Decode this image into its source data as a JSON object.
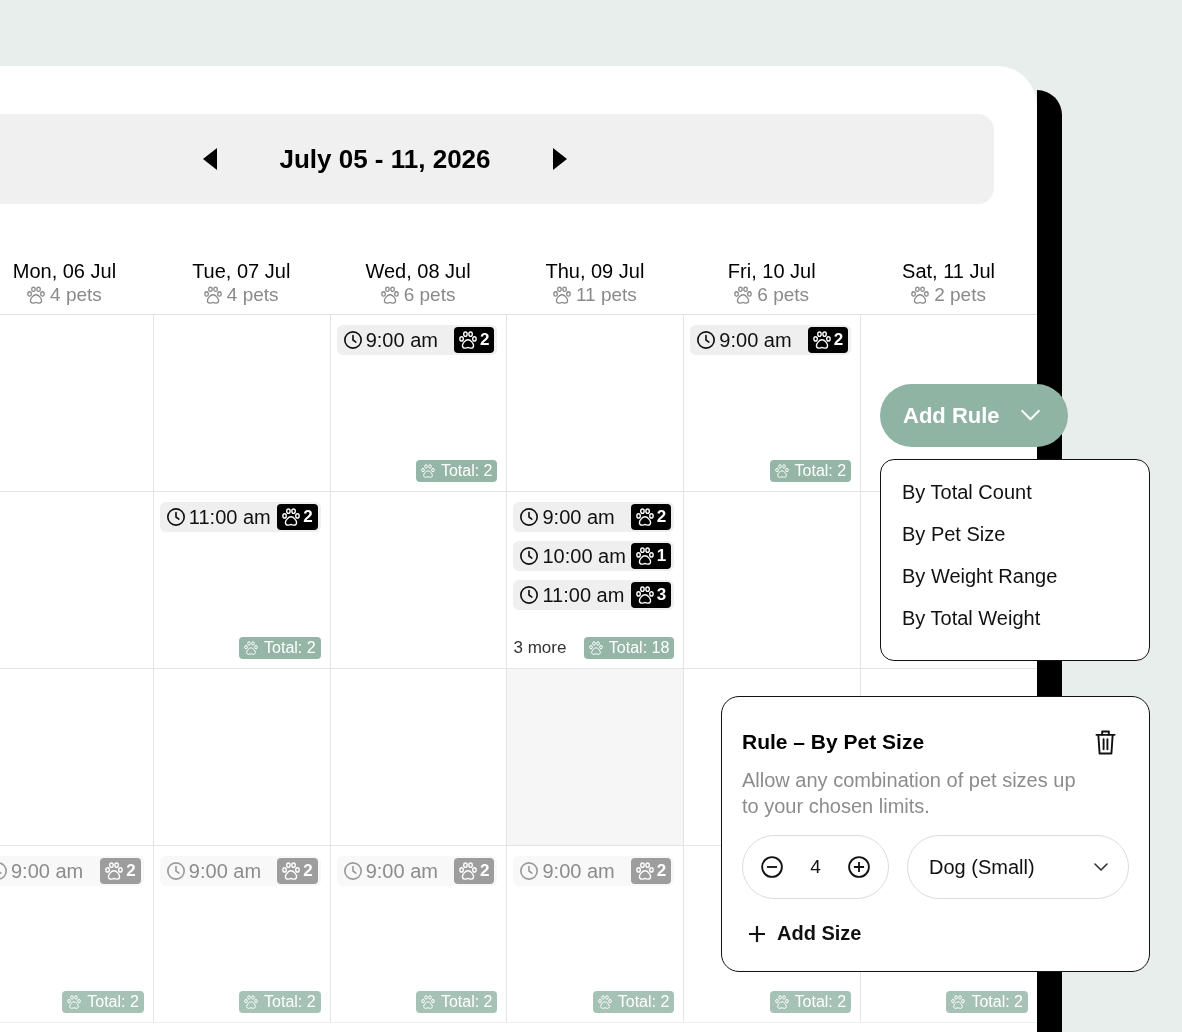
{
  "week_nav": {
    "title": "July 05 - 11, 2026"
  },
  "days": [
    {
      "label": "Mon, 06 Jul",
      "pets": "4 pets"
    },
    {
      "label": "Tue, 07 Jul",
      "pets": "4 pets"
    },
    {
      "label": "Wed, 08 Jul",
      "pets": "6 pets"
    },
    {
      "label": "Thu, 09 Jul",
      "pets": "11 pets"
    },
    {
      "label": "Fri, 10 Jul",
      "pets": "6 pets"
    },
    {
      "label": "Sat, 11 Jul",
      "pets": "2 pets"
    }
  ],
  "rows": [
    {
      "cells": [
        {
          "kind": "plain"
        },
        {
          "kind": "plain"
        },
        {
          "kind": "plain",
          "events": [
            {
              "time": "9:00 am",
              "count": "2",
              "faded": false
            }
          ],
          "total": {
            "label": "Total: 2",
            "faded": false
          }
        },
        {
          "kind": "plain"
        },
        {
          "kind": "plain",
          "events": [
            {
              "time": "9:00 am",
              "count": "2",
              "faded": false
            }
          ],
          "total": {
            "label": "Total: 2",
            "faded": false
          }
        },
        {
          "kind": "plain"
        }
      ]
    },
    {
      "cells": [
        {
          "kind": "plain"
        },
        {
          "kind": "plain",
          "events": [
            {
              "time": "11:00 am",
              "count": "2",
              "faded": false
            }
          ],
          "total": {
            "label": "Total: 2",
            "faded": false
          }
        },
        {
          "kind": "plain"
        },
        {
          "kind": "plain",
          "events": [
            {
              "time": "9:00 am",
              "count": "2",
              "faded": false
            },
            {
              "time": "10:00 am",
              "count": "1",
              "faded": false
            },
            {
              "time": "11:00 am",
              "count": "3",
              "faded": false
            }
          ],
          "more": "3 more",
          "total": {
            "label": "Total: 18",
            "faded": false
          }
        },
        {
          "kind": "plain"
        },
        {
          "kind": "plain"
        }
      ]
    },
    {
      "cells": [
        {
          "kind": "plain"
        },
        {
          "kind": "plain"
        },
        {
          "kind": "plain"
        },
        {
          "kind": "shaded"
        },
        {
          "kind": "plain"
        },
        {
          "kind": "plain"
        }
      ]
    },
    {
      "cells": [
        {
          "kind": "plain",
          "events": [
            {
              "time": "9:00 am",
              "count": "2",
              "faded": true
            }
          ],
          "total": {
            "label": "Total: 2",
            "faded": true
          }
        },
        {
          "kind": "plain",
          "events": [
            {
              "time": "9:00 am",
              "count": "2",
              "faded": true
            }
          ],
          "total": {
            "label": "Total: 2",
            "faded": true
          }
        },
        {
          "kind": "plain",
          "events": [
            {
              "time": "9:00 am",
              "count": "2",
              "faded": true
            }
          ],
          "total": {
            "label": "Total: 2",
            "faded": true
          }
        },
        {
          "kind": "plain",
          "events": [
            {
              "time": "9:00 am",
              "count": "2",
              "faded": true
            }
          ],
          "total": {
            "label": "Total: 2",
            "faded": true
          }
        },
        {
          "kind": "plain",
          "total": {
            "label": "Total: 2",
            "faded": true
          }
        },
        {
          "kind": "plain",
          "total": {
            "label": "Total: 2",
            "faded": true
          }
        }
      ]
    }
  ],
  "add_rule": {
    "label": "Add Rule",
    "expanded": true
  },
  "rule_menu": {
    "items": [
      "By Total Count",
      "By Pet Size",
      "By Weight Range",
      "By Total Weight"
    ]
  },
  "rule_card": {
    "title": "Rule – By Pet Size",
    "description": "Allow any combination of pet sizes up to your chosen limits.",
    "quantity": "4",
    "size": "Dog (Small)",
    "add_size": "Add Size"
  }
}
